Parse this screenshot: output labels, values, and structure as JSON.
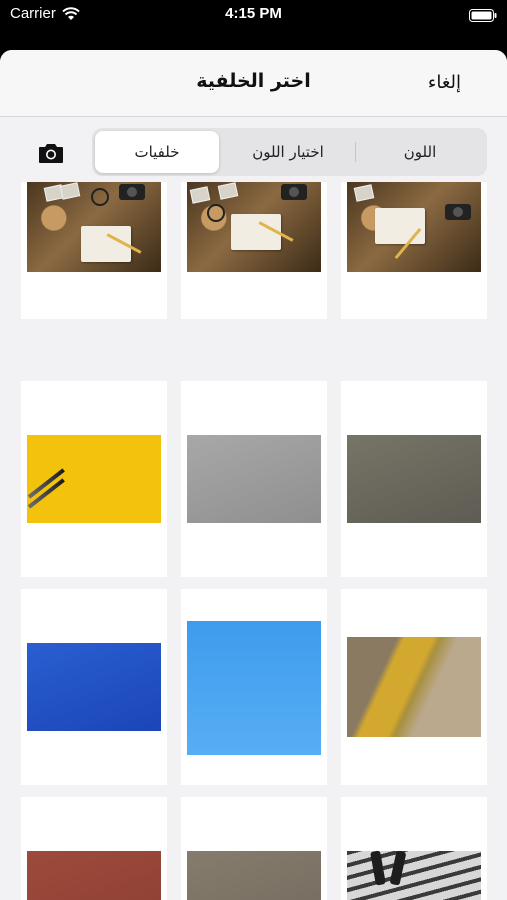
{
  "status_bar": {
    "carrier": "Carrier",
    "time": "4:15 PM"
  },
  "nav": {
    "title": "اختر الخلفية",
    "cancel_label": "إلغاء"
  },
  "segments": {
    "color_label": "اللون",
    "color_picker_label": "اختيار اللون",
    "backgrounds_label": "خلفيات",
    "selected": "خلفيات"
  },
  "icons": {
    "camera": "camera-icon",
    "wifi": "wifi-icon",
    "battery": "battery-icon"
  },
  "backgrounds": [
    {
      "id": "desk-1",
      "kind": "photo",
      "colors": [
        "#4b3620",
        "#8b6a42"
      ]
    },
    {
      "id": "desk-2",
      "kind": "photo",
      "colors": [
        "#4b3620",
        "#8b6a42"
      ]
    },
    {
      "id": "desk-3",
      "kind": "photo",
      "colors": [
        "#4b3620",
        "#8b6a42"
      ]
    },
    {
      "id": "yellow-pencils",
      "kind": "photo",
      "colors": [
        "#f3c20c"
      ]
    },
    {
      "id": "grey-paper",
      "kind": "texture",
      "colors": [
        "#a8a8a8"
      ]
    },
    {
      "id": "dark-grey-paper",
      "kind": "texture",
      "colors": [
        "#777567"
      ]
    },
    {
      "id": "blue-paper",
      "kind": "texture",
      "colors": [
        "#2a5fd1"
      ]
    },
    {
      "id": "sky-blue",
      "kind": "texture",
      "colors": [
        "#4aa5f0"
      ]
    },
    {
      "id": "gold-fabric",
      "kind": "photo",
      "colors": [
        "#d2a82e",
        "#8a7a62"
      ]
    },
    {
      "id": "red-brick",
      "kind": "texture",
      "colors": [
        "#9d4a3c"
      ]
    },
    {
      "id": "sand-texture",
      "kind": "texture",
      "colors": [
        "#867c6e"
      ]
    },
    {
      "id": "street-walker",
      "kind": "photo",
      "colors": [
        "#3a3a3a",
        "#d7d7d7"
      ]
    }
  ]
}
